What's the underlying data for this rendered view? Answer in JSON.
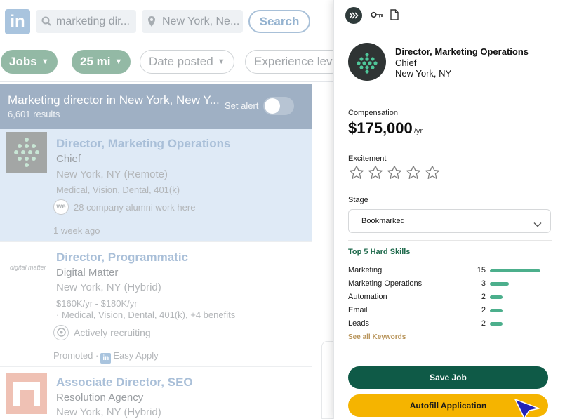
{
  "background": {
    "search": {
      "keywords": "marketing dir...",
      "location": "New York, Ne...",
      "button": "Search"
    },
    "filters": [
      {
        "label": "Jobs",
        "selected": true
      },
      {
        "label": "25 mi",
        "selected": true
      },
      {
        "label": "Date posted",
        "selected": false
      },
      {
        "label": "Experience lev",
        "selected": false
      }
    ],
    "results": {
      "title": "Marketing director in New York, New Y...",
      "count": "6,601 results",
      "set_alert": "Set alert"
    },
    "jobs": [
      {
        "title": "Director, Marketing Operations",
        "company": "Chief",
        "location": "New York, NY (Remote)",
        "benefits": "Medical, Vision, Dental, 401(k)",
        "insight_icon_text": "we",
        "insight": "28 company alumni work here",
        "footer": "1 week ago"
      },
      {
        "logo_text": "digital matter",
        "title": "Director, Programmatic",
        "company": "Digital Matter",
        "location": "New York, NY (Hybrid)",
        "salary": "$160K/yr - $180K/yr",
        "benefits": "· Medical, Vision, Dental, 401(k), +4 benefits",
        "insight": "Actively recruiting",
        "footer_promoted": "Promoted ·",
        "footer_apply": "Easy Apply"
      },
      {
        "title": "Associate Director, SEO",
        "company": "Resolution Agency",
        "location": "New York, NY (Hybrid)"
      }
    ]
  },
  "panel": {
    "job": {
      "title": "Director, Marketing Operations",
      "company": "Chief",
      "location": "New York, NY"
    },
    "compensation_label": "Compensation",
    "compensation_value": "$175,000",
    "compensation_period": "/yr",
    "excitement_label": "Excitement",
    "excitement_rating": 0,
    "excitement_max": 5,
    "stage_label": "Stage",
    "stage_value": "Bookmarked",
    "skills_title": "Top 5 Hard Skills",
    "skills": [
      {
        "name": "Marketing",
        "count": "15",
        "value": 15
      },
      {
        "name": "Marketing Operations",
        "count": "3",
        "value": 3
      },
      {
        "name": "Automation",
        "count": "2",
        "value": 2
      },
      {
        "name": "Email",
        "count": "2",
        "value": 2
      },
      {
        "name": "Leads",
        "count": "2",
        "value": 2
      }
    ],
    "see_all": "See all Keywords",
    "save_button": "Save Job",
    "autofill_button": "Autofill Application",
    "colors": {
      "primary": "#0f5a47",
      "accent": "#f5b400",
      "skill_bar": "#4caf8c",
      "link": "#b8945a"
    }
  }
}
